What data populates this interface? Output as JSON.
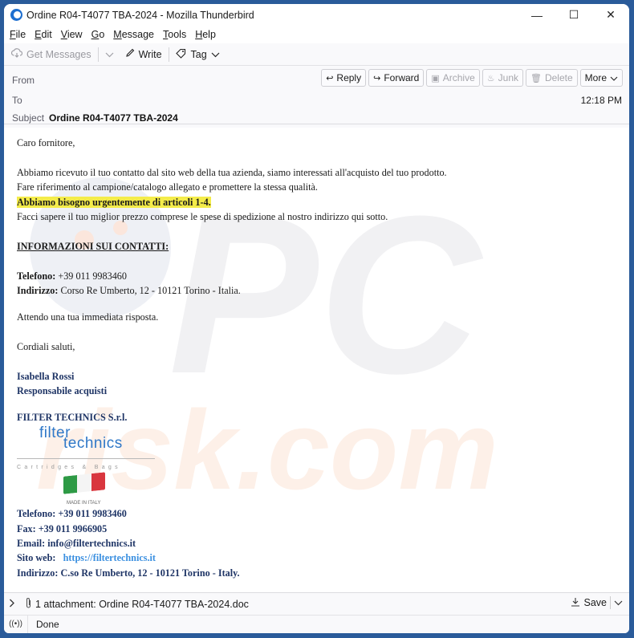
{
  "window": {
    "title": "Ordine R04-T4077 TBA-2024 - Mozilla Thunderbird",
    "controls": {
      "minimize": "—",
      "maximize": "☐",
      "close": "✕"
    }
  },
  "menubar": {
    "items": [
      {
        "label": "File",
        "accel": "F",
        "rest": "ile"
      },
      {
        "label": "Edit",
        "accel": "E",
        "rest": "dit"
      },
      {
        "label": "View",
        "accel": "V",
        "rest": "iew"
      },
      {
        "label": "Go",
        "accel": "G",
        "rest": "o"
      },
      {
        "label": "Message",
        "accel": "M",
        "rest": "essage"
      },
      {
        "label": "Tools",
        "accel": "T",
        "rest": "ools"
      },
      {
        "label": "Help",
        "accel": "H",
        "rest": "elp"
      }
    ]
  },
  "toolbar": {
    "get_messages": "Get Messages",
    "write": "Write",
    "tag": "Tag"
  },
  "header": {
    "from_label": "From",
    "to_label": "To",
    "subject_label": "Subject",
    "subject": "Ordine R04-T4077 TBA-2024",
    "time": "12:18 PM",
    "actions": {
      "reply": "Reply",
      "forward": "Forward",
      "archive": "Archive",
      "junk": "Junk",
      "delete": "Delete",
      "more": "More"
    }
  },
  "message": {
    "greeting": "Caro fornitore,",
    "line1": "Abbiamo ricevuto il tuo contatto dal sito web della tua azienda, siamo interessati all'acquisto del tuo prodotto.",
    "line2": "Fare riferimento al campione/catalogo allegato e promettere la stessa qualità.",
    "highlight": "Abbiamo bisogno urgentemente di articoli 1-4.",
    "line3": "Facci sapere il tuo miglior prezzo comprese le spese di spedizione al nostro indirizzo qui sotto.",
    "contacts_heading": "INFORMAZIONI SUI CONTATTI:",
    "phone_label": "Telefono:",
    "phone": " +39 011 9983460",
    "address_label": "Indirizzo:",
    "address": " Corso Re Umberto, 12 - 10121 Torino - Italia.",
    "awaiting": "Attendo una tua immediata risposta.",
    "closing": "Cordiali saluti,",
    "sender_name": "Isabella Rossi",
    "sender_role": "Responsabile acquisti",
    "company": "FILTER TECHNICS S.r.l.",
    "logo": {
      "word1": "filter",
      "word2": "technics",
      "tagline": "Cartridges & Bags"
    },
    "flag_caption": "MADE IN ITALY",
    "sig_phone": "Telefono: +39 011 9983460",
    "sig_fax": "Fax: +39 011 9966905",
    "sig_email": "Email: info@filtertechnics.it",
    "sig_site_label": "Sito web:",
    "sig_site": "https://filtertechnics.it",
    "sig_address": "Indirizzo: C.so Re Umberto, 12 - 10121 Torino - Italy."
  },
  "attachment": {
    "summary": "1 attachment: Ordine R04-T4077 TBA-2024.doc",
    "save": "Save"
  },
  "status": {
    "text": "Done"
  },
  "watermark": {
    "line1": "PC",
    "line2": "risk.com"
  },
  "colors": {
    "highlight": "#f4ec4a",
    "signature": "#1f3566",
    "link": "#3a8fe0",
    "logo": "#2f78c8"
  }
}
